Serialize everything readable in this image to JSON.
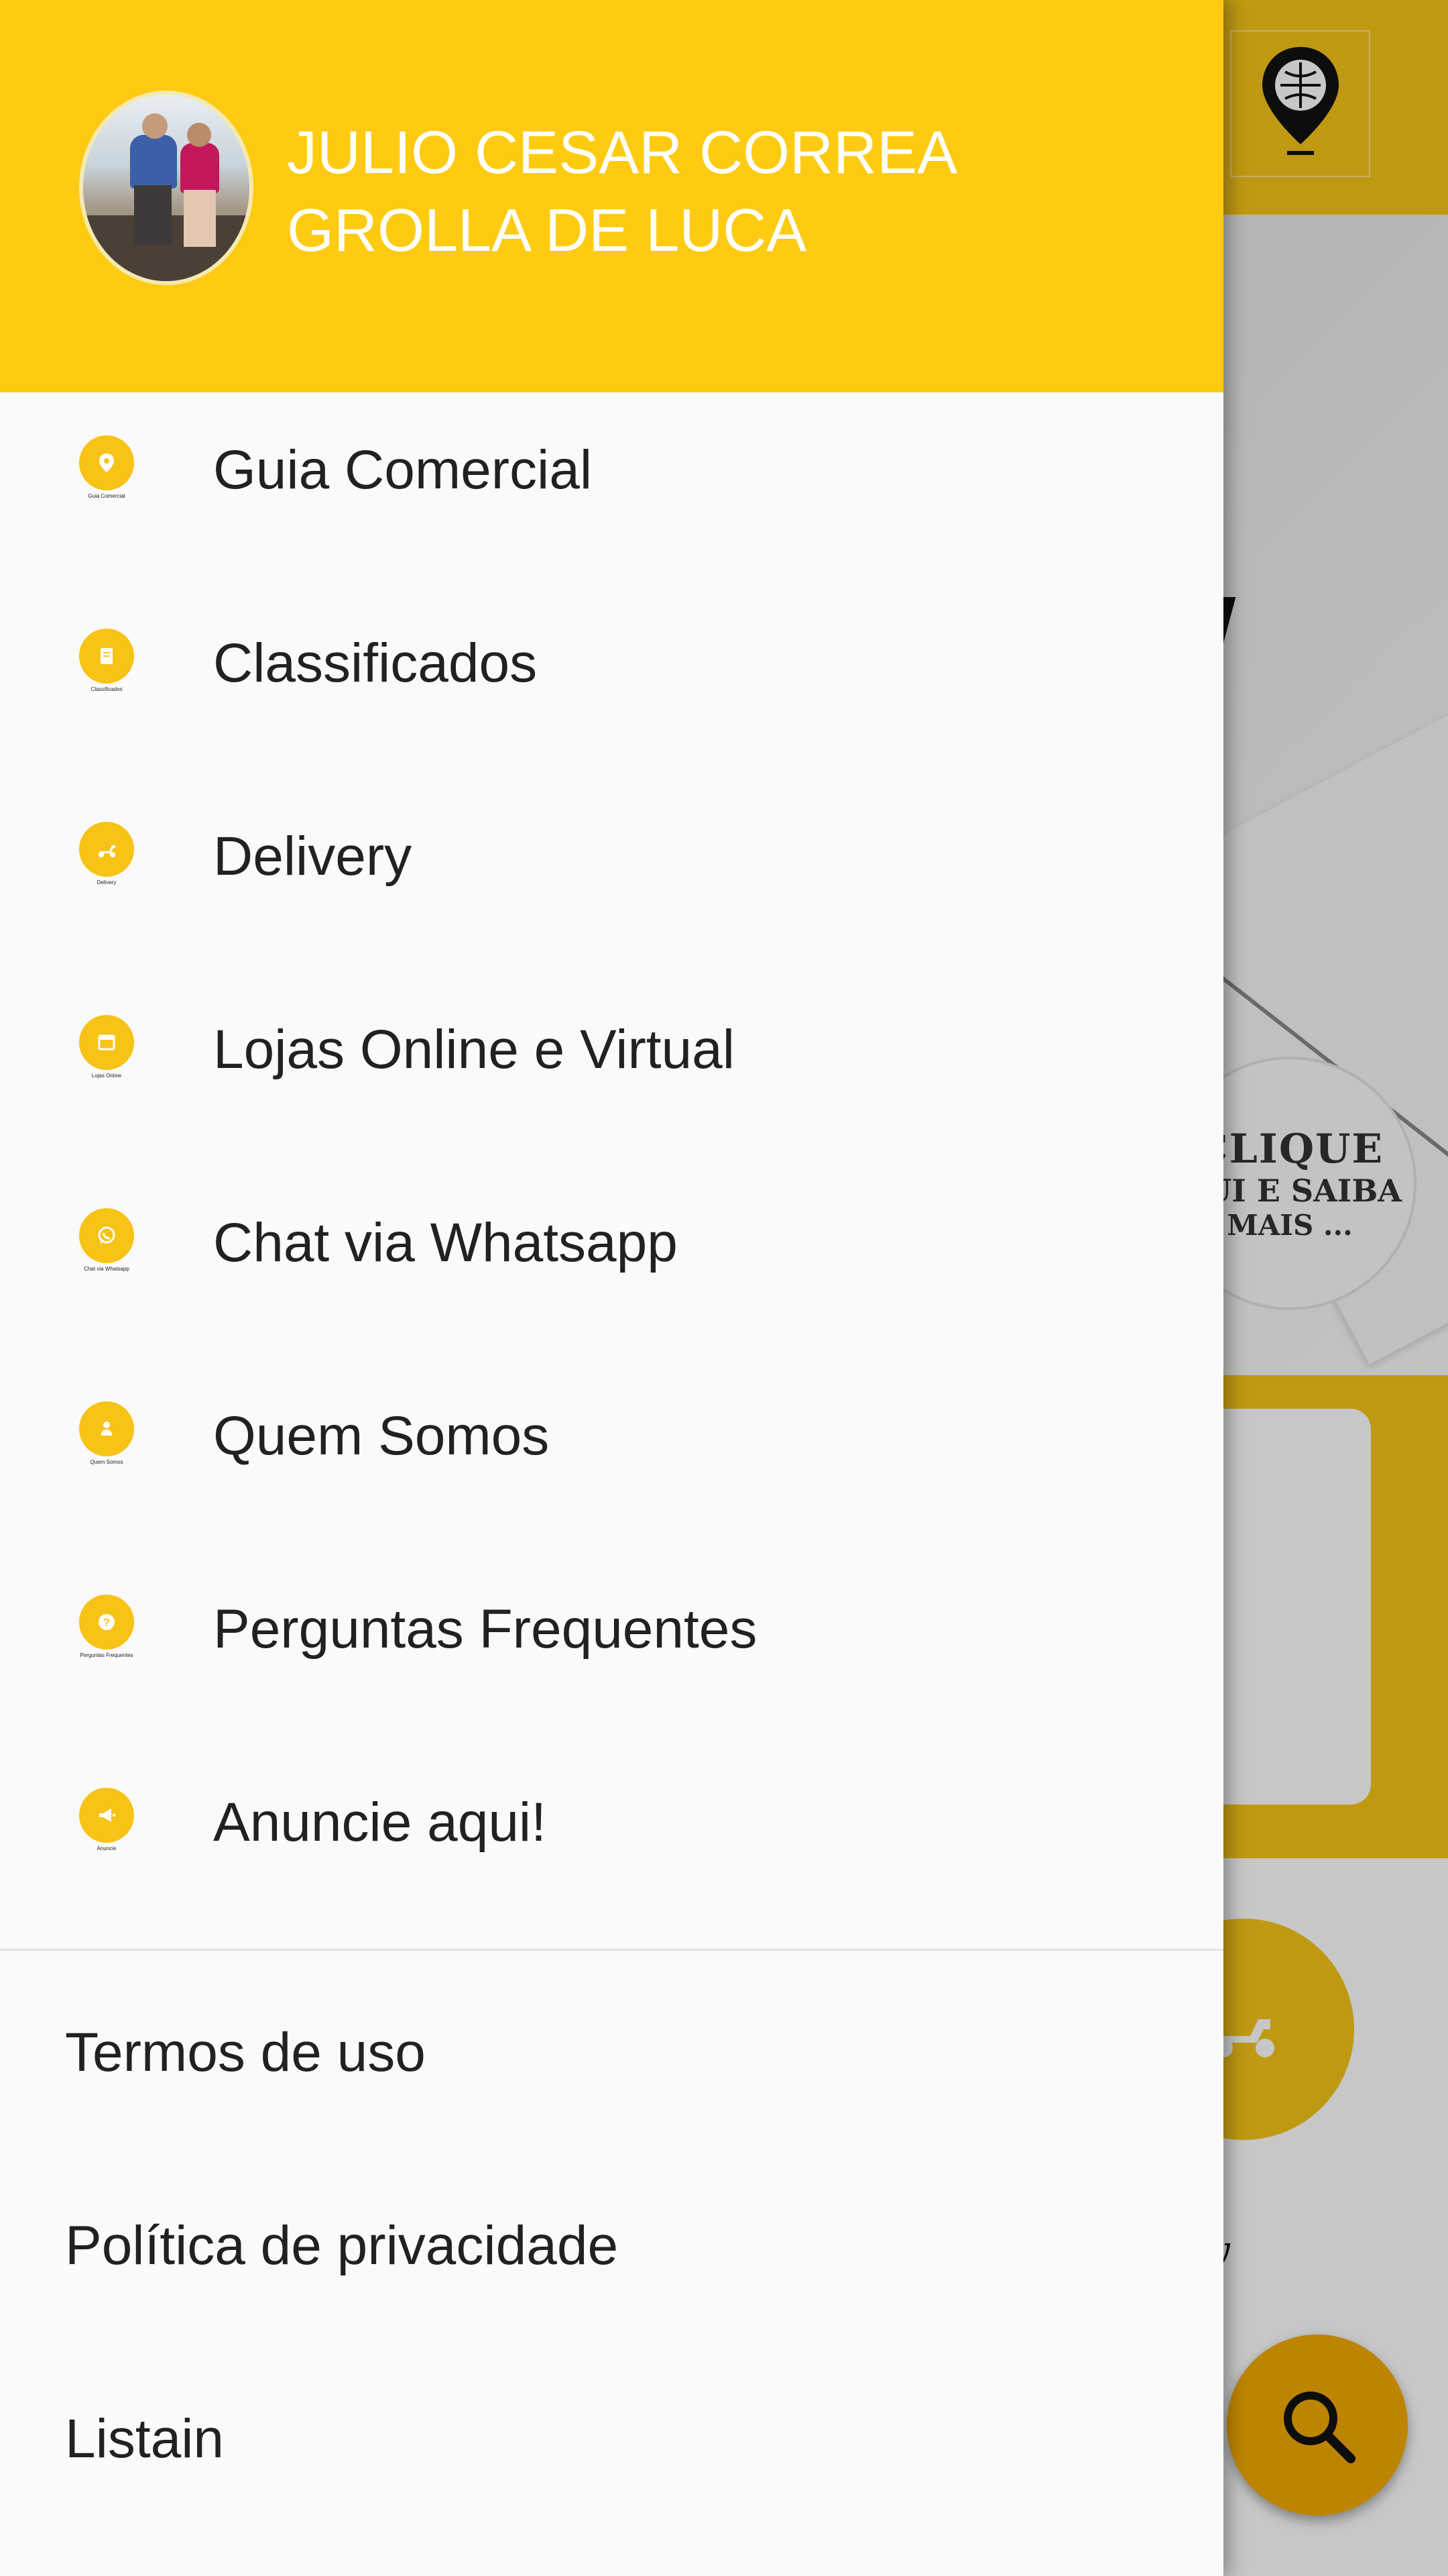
{
  "background_app": {
    "clique_line1": "CLIQUE",
    "clique_line2": "QUI E SAIBA",
    "clique_line3": "MAIS ...",
    "delivery_label": "ery"
  },
  "drawer": {
    "user_name": "JULIO CESAR CORREA GROLLA DE LUCA",
    "menu_items": [
      {
        "label": "Guia Comercial",
        "icon": "location-pin-icon",
        "caption": "Guia Comercial"
      },
      {
        "label": "Classificados",
        "icon": "document-icon",
        "caption": "Classificados"
      },
      {
        "label": "Delivery",
        "icon": "moped-icon",
        "caption": "Delivery"
      },
      {
        "label": "Lojas Online e Virtual",
        "icon": "storefront-icon",
        "caption": "Lojas Online"
      },
      {
        "label": "Chat via Whatsapp",
        "icon": "whatsapp-icon",
        "caption": "Chat via Whatsapp"
      },
      {
        "label": "Quem Somos",
        "icon": "person-icon",
        "caption": "Quem Somos"
      },
      {
        "label": "Perguntas Frequentes",
        "icon": "question-icon",
        "caption": "Perguntas Frequentes"
      },
      {
        "label": "Anuncie aqui!",
        "icon": "megaphone-icon",
        "caption": "Anuncie"
      }
    ],
    "footer_items": [
      {
        "label": "Termos de uso"
      },
      {
        "label": "Política de privacidade"
      },
      {
        "label": "Listain"
      }
    ]
  },
  "colors": {
    "header_yellow": "#fecb12",
    "icon_yellow": "#f8c317",
    "fab_orange": "#f2a900"
  }
}
